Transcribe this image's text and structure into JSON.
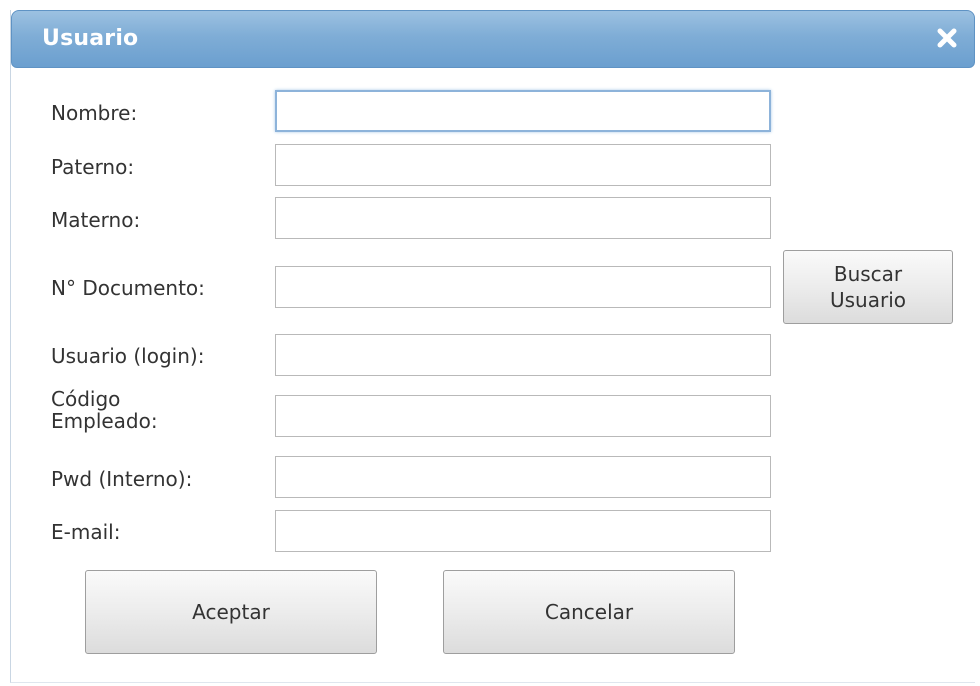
{
  "dialog": {
    "title": "Usuario",
    "close_icon": "close-icon"
  },
  "form": {
    "nombre": {
      "label": "Nombre:",
      "value": ""
    },
    "paterno": {
      "label": "Paterno:",
      "value": ""
    },
    "materno": {
      "label": "Materno:",
      "value": ""
    },
    "documento": {
      "label": "N° Documento:",
      "value": ""
    },
    "login": {
      "label": "Usuario (login):",
      "value": ""
    },
    "codigo": {
      "label": "Código\nEmpleado:",
      "value": ""
    },
    "pwd": {
      "label": "Pwd (Interno):",
      "value": ""
    },
    "email": {
      "label": "E-mail:",
      "value": ""
    }
  },
  "buttons": {
    "search_label": "Buscar\nUsuario",
    "accept_label": "Aceptar",
    "cancel_label": "Cancelar"
  },
  "colors": {
    "titlebar": "#7fadd6",
    "title_text": "#ffffff"
  }
}
